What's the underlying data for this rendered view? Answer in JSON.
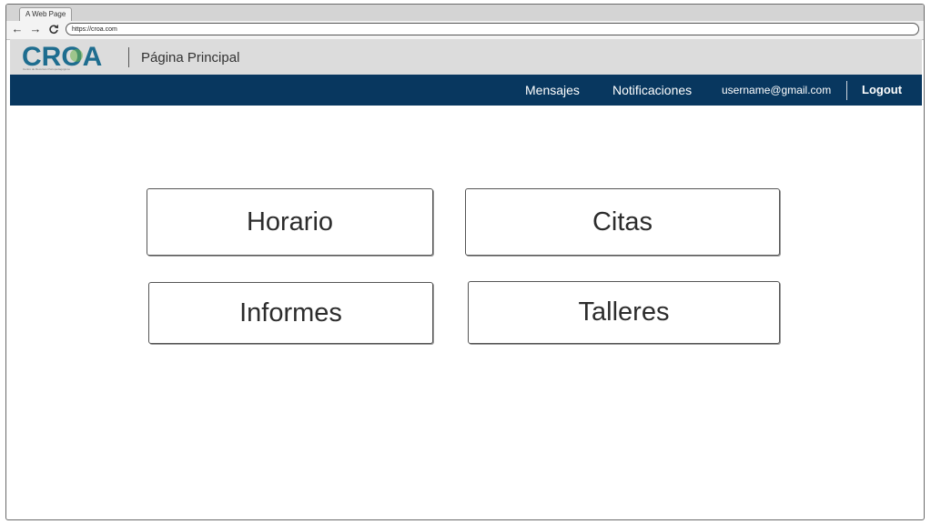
{
  "browser": {
    "tab_title": "A Web Page",
    "url": "https://croa.com",
    "back_icon": "arrow-left-icon",
    "forward_icon": "arrow-right-icon",
    "reload_icon": "reload-icon"
  },
  "header": {
    "logo_text": "CROA",
    "logo_subtitle": "Centro de Recursos Psicopedagógicos",
    "page_title": "Página Principal",
    "background": "#dcdcdc"
  },
  "navbar": {
    "background": "#08375f",
    "messages": "Mensajes",
    "notifications": "Notificaciones",
    "user_email": "username@gmail.com",
    "logout": "Logout"
  },
  "tiles": {
    "horario": "Horario",
    "citas": "Citas",
    "informes": "Informes",
    "talleres": "Talleres"
  }
}
